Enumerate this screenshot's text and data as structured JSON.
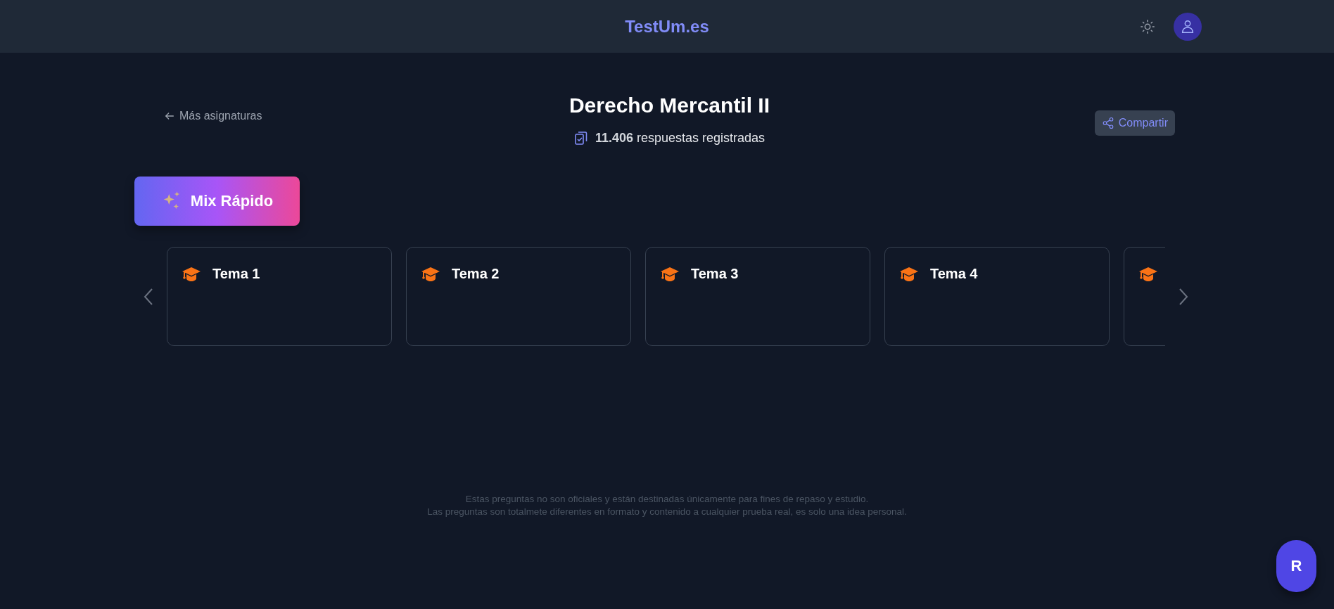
{
  "header": {
    "logo": "TestUm.es"
  },
  "back_link": "Más asignaturas",
  "subject": {
    "title": "Derecho Mercantil II",
    "count": "11.406",
    "count_label": "respuestas registradas"
  },
  "share_button": "Compartir",
  "mix_button": "Mix Rápido",
  "cards": [
    {
      "kind": "full",
      "title": "Tema 1"
    },
    {
      "kind": "full",
      "title": "Tema 2"
    },
    {
      "kind": "full",
      "title": "Tema 3"
    },
    {
      "kind": "full",
      "title": "Tema 4"
    },
    {
      "kind": "cut"
    }
  ],
  "footer": [
    "Estas preguntas no son oficiales y están destinadas únicamente para fines de repaso y estudio.",
    "Las preguntas son totalmete diferentes en formato y contenido a cualquier prueba real, es solo una idea personal."
  ],
  "floating_button": "R"
}
